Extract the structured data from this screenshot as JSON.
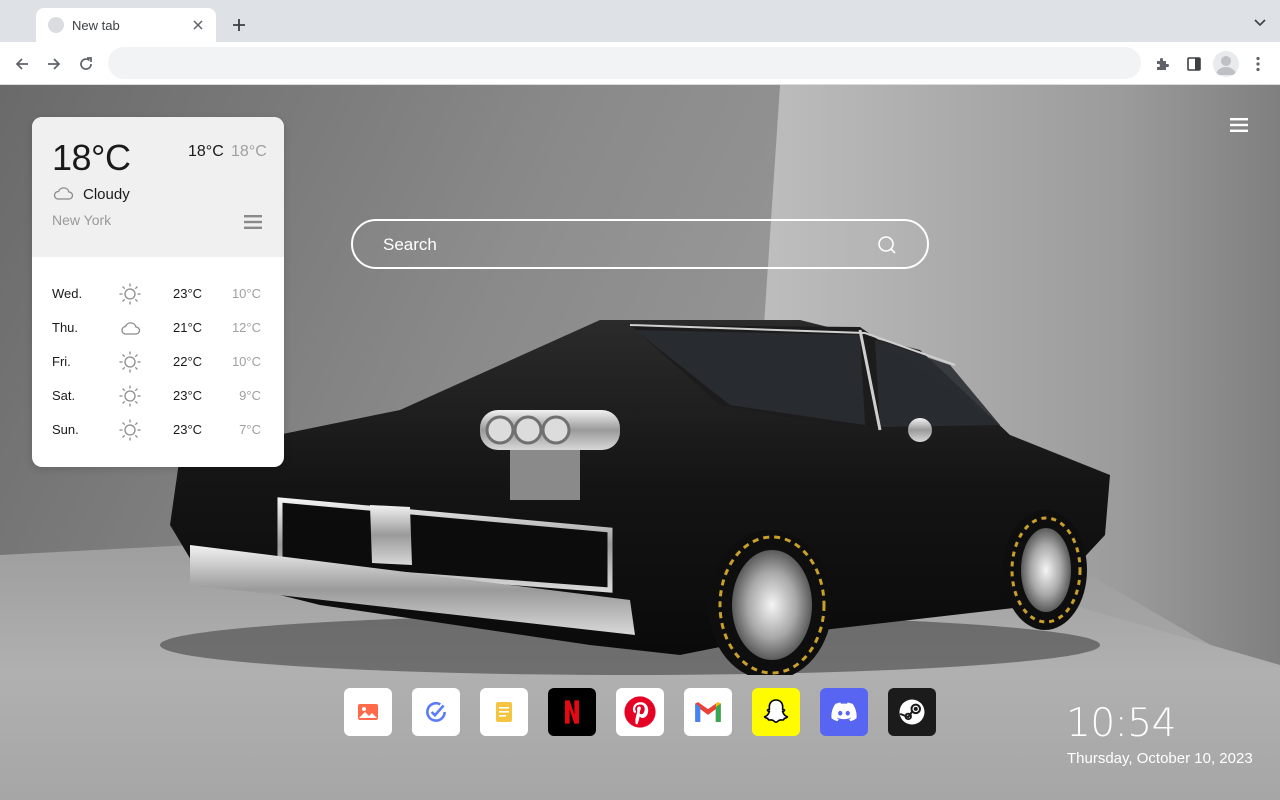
{
  "browser": {
    "tab_title": "New tab",
    "address_value": "",
    "address_placeholder": ""
  },
  "weather": {
    "current_temp": "18°C",
    "high": "18°C",
    "low": "18°C",
    "condition": "Cloudy",
    "condition_icon": "cloud-icon",
    "city": "New York",
    "forecast": [
      {
        "day": "Wed.",
        "icon": "sun-icon",
        "high": "23°C",
        "low": "10°C"
      },
      {
        "day": "Thu.",
        "icon": "cloud-icon",
        "high": "21°C",
        "low": "12°C"
      },
      {
        "day": "Fri.",
        "icon": "sun-icon",
        "high": "22°C",
        "low": "10°C"
      },
      {
        "day": "Sat.",
        "icon": "sun-icon",
        "high": "23°C",
        "low": "9°C"
      },
      {
        "day": "Sun.",
        "icon": "sun-icon",
        "high": "23°C",
        "low": "7°C"
      }
    ]
  },
  "search": {
    "placeholder": "Search"
  },
  "shortcuts": [
    {
      "name": "photos",
      "icon": "image-icon",
      "bg": "#ffffff"
    },
    {
      "name": "tasks",
      "icon": "check-circle-icon",
      "bg": "#ffffff"
    },
    {
      "name": "notes",
      "icon": "note-icon",
      "bg": "#ffffff"
    },
    {
      "name": "netflix",
      "icon": "netflix-icon",
      "bg": "#000000"
    },
    {
      "name": "pinterest",
      "icon": "pinterest-icon",
      "bg": "#ffffff"
    },
    {
      "name": "gmail",
      "icon": "gmail-icon",
      "bg": "#ffffff"
    },
    {
      "name": "snapchat",
      "icon": "snapchat-icon",
      "bg": "#fffc00"
    },
    {
      "name": "discord",
      "icon": "discord-icon",
      "bg": "#5865f2"
    },
    {
      "name": "steam",
      "icon": "steam-icon",
      "bg": "#1b1b1b"
    }
  ],
  "clock": {
    "time": "10:54",
    "date": "Thursday, October 10, 2023"
  },
  "colors": {
    "page_text": "#ffffff",
    "weather_card_bg": "#ffffff",
    "weather_header_bg": "#f0f0f0",
    "muted_text": "#9a9a9a"
  }
}
